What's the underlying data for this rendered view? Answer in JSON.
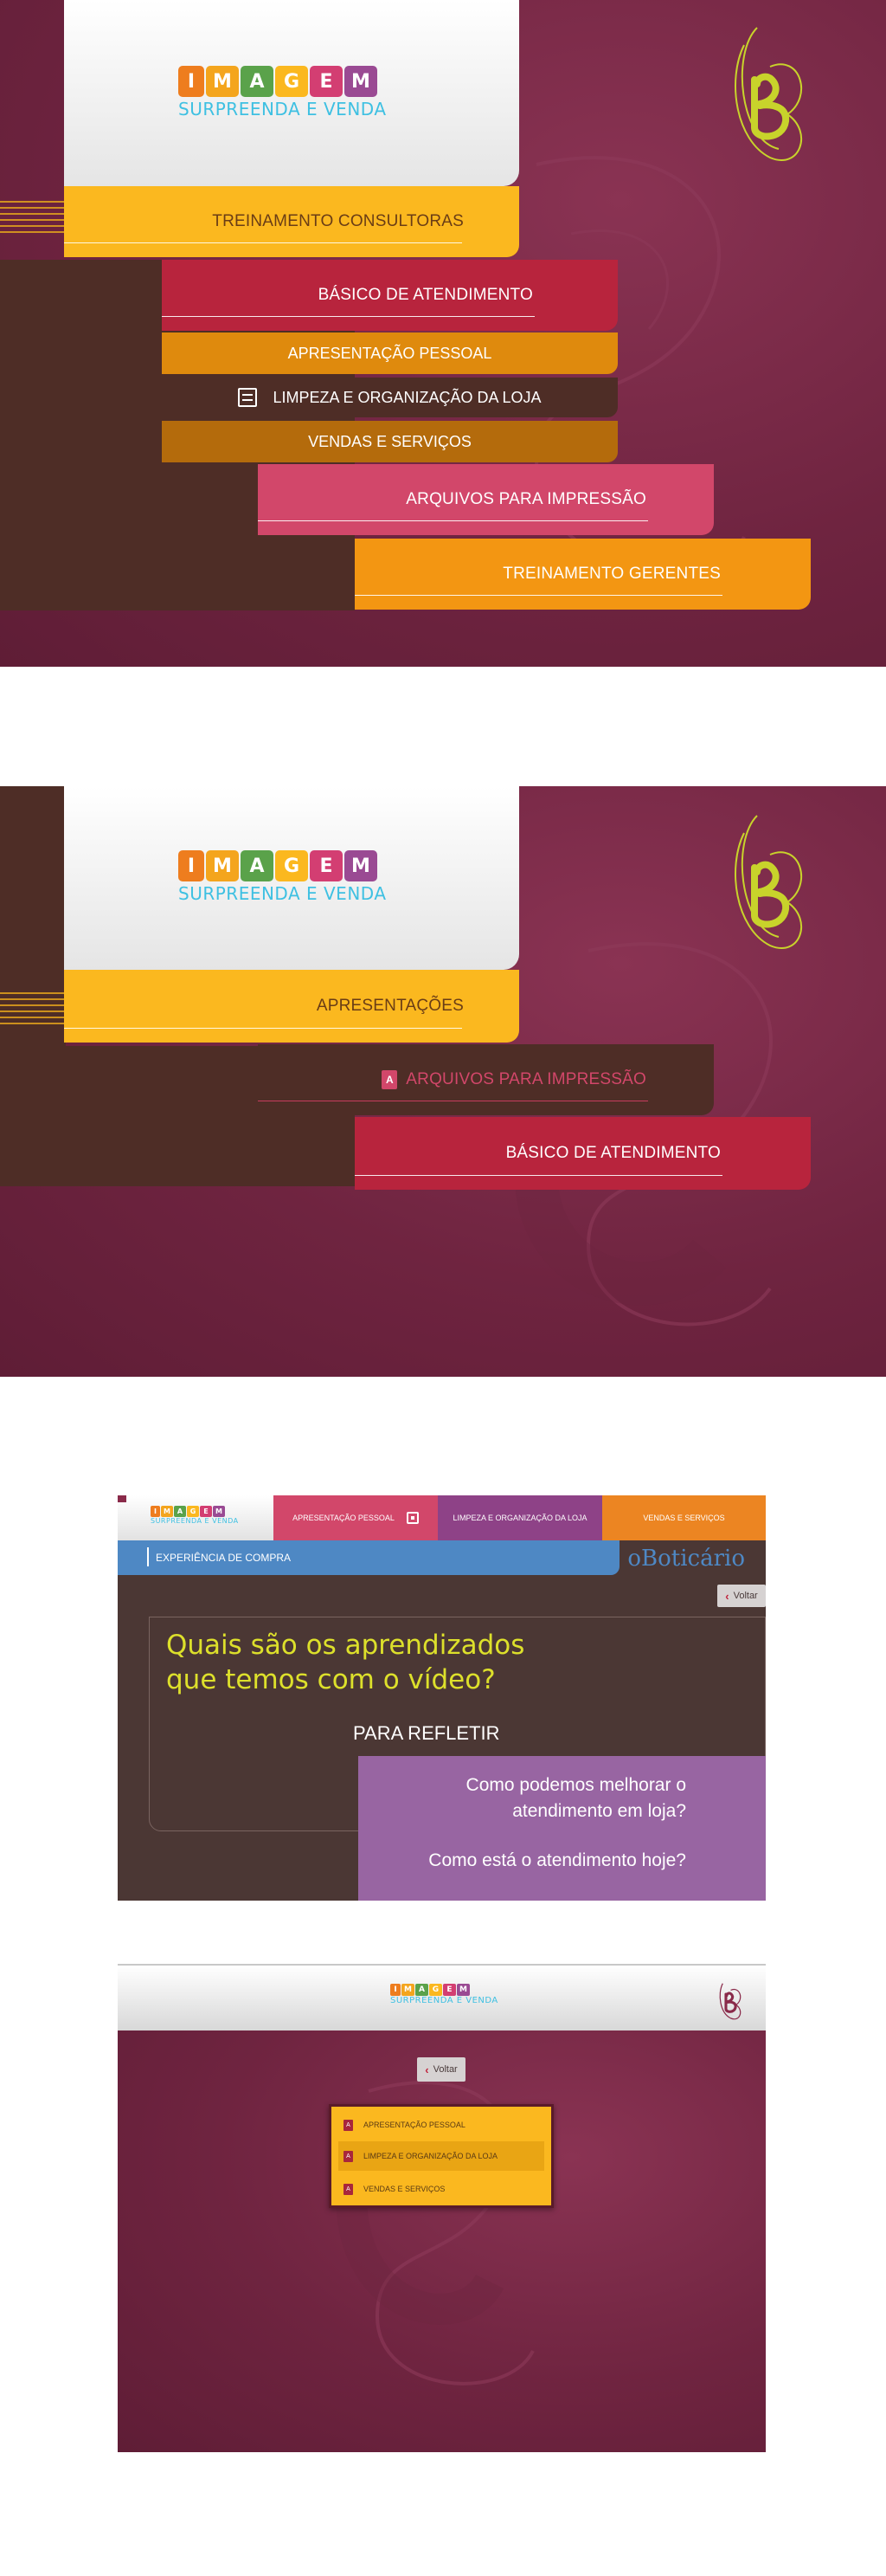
{
  "logo": {
    "letters": [
      "I",
      "M",
      "A",
      "G",
      "E",
      "M"
    ],
    "letter_colors": [
      "#ee7d1e",
      "#f4a51d",
      "#5aa24a",
      "#fbb81f",
      "#d33e72",
      "#9a4a93"
    ],
    "subtitle": "SURPREENDA E VENDA"
  },
  "brand": {
    "mark": "b-mark-icon",
    "name": "oBoticário",
    "accent": "#c8d32b"
  },
  "screen1": {
    "menu": {
      "consultoras": "TREINAMENTO CONSULTORAS",
      "basico": "BÁSICO DE ATENDIMENTO",
      "items": [
        {
          "label": "APRESENTAÇÃO PESSOAL"
        },
        {
          "label": "LIMPEZA E ORGANIZAÇÃO DA LOJA",
          "icon": "film-icon"
        },
        {
          "label": "VENDAS E SERVIÇOS"
        }
      ],
      "arquivos": "ARQUIVOS PARA IMPRESSÃO",
      "gerentes": "TREINAMENTO GERENTES"
    }
  },
  "screen2": {
    "menu": {
      "apresentacoes": "APRESENTAÇÕES",
      "arquivos": "ARQUIVOS PARA IMPRESSÃO",
      "arquivos_icon": "pdf-icon",
      "basico": "BÁSICO DE ATENDIMENTO"
    }
  },
  "screen3": {
    "tabs": [
      {
        "label": "APRESENTAÇÃO PESSOAL",
        "icon": "film-icon"
      },
      {
        "label": "LIMPEZA E ORGANIZAÇÃO DA LOJA"
      },
      {
        "label": "VENDAS E SERVIÇOS"
      }
    ],
    "section": "EXPERIÊNCIA DE COMPRA",
    "brand": "oBoticário",
    "back": "Voltar",
    "question": "Quais são os aprendizados que temos com o vídeo?",
    "question_line1": "Quais são os aprendizados",
    "question_line2": "que temos com o vídeo?",
    "reflect": "PARA REFLETIR",
    "q1_line1": "Como podemos melhorar o",
    "q1_line2": "atendimento em loja?",
    "q2": "Como está o atendimento hoje?"
  },
  "screen4": {
    "back": "Voltar",
    "files": [
      {
        "label": "APRESENTAÇÃO PESSOAL",
        "icon": "pdf-icon"
      },
      {
        "label": "LIMPEZA E ORGANIZAÇÃO DA LOJA",
        "icon": "pdf-icon"
      },
      {
        "label": "VENDAS E SERVIÇOS",
        "icon": "pdf-icon"
      }
    ]
  }
}
